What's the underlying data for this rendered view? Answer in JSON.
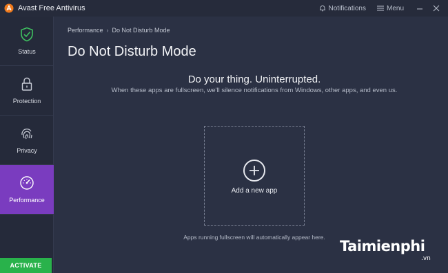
{
  "titlebar": {
    "app_title": "Avast Free Antivirus",
    "notifications_label": "Notifications",
    "menu_label": "Menu"
  },
  "sidebar": {
    "items": [
      {
        "label": "Status",
        "icon": "shield-check-icon"
      },
      {
        "label": "Protection",
        "icon": "lock-icon"
      },
      {
        "label": "Privacy",
        "icon": "fingerprint-icon"
      },
      {
        "label": "Performance",
        "icon": "speedometer-icon"
      }
    ],
    "activate_label": "ACTIVATE"
  },
  "main": {
    "breadcrumb": {
      "parent": "Performance",
      "separator": "›",
      "current": "Do Not Disturb Mode"
    },
    "title": "Do Not Disturb Mode",
    "headline": "Do your thing. Uninterrupted.",
    "subline": "When these apps are fullscreen, we'll silence notifications from Windows, other apps, and even us.",
    "add_app_label": "Add a new app",
    "footer_note": "Apps running fullscreen will automatically appear here."
  },
  "watermark": {
    "brand": "Taimienphi",
    "suffix": ".vn"
  },
  "colors": {
    "background": "#2b3144",
    "sidebar": "#252a3a",
    "active": "#7a3cbf",
    "activate": "#29b24b",
    "status_green": "#3fc160",
    "logo_orange": "#f07a1c"
  }
}
